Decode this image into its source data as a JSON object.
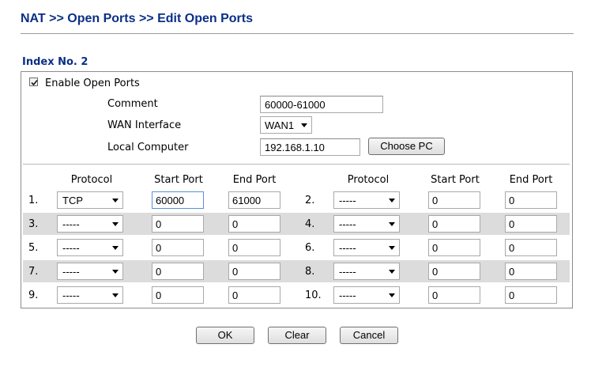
{
  "breadcrumb": "NAT >> Open Ports >> Edit Open Ports",
  "index_label": "Index No. 2",
  "enable": {
    "label": "Enable Open Ports",
    "checked": true
  },
  "form": {
    "comment_label": "Comment",
    "comment_value": "60000-61000",
    "wan_label": "WAN Interface",
    "wan_value": "WAN1",
    "local_label": "Local Computer",
    "local_value": "192.168.1.10",
    "choose_pc": "Choose PC"
  },
  "table": {
    "headers": {
      "protocol_left": "Protocol",
      "start_left": "Start Port",
      "end_left": "End Port",
      "protocol_right": "Protocol",
      "start_right": "Start Port",
      "end_right": "End Port"
    },
    "rows": [
      {
        "left": {
          "num": "1.",
          "protocol": "TCP",
          "start": "60000",
          "end": "61000"
        },
        "right": {
          "num": "2.",
          "protocol": "-----",
          "start": "0",
          "end": "0"
        }
      },
      {
        "left": {
          "num": "3.",
          "protocol": "-----",
          "start": "0",
          "end": "0"
        },
        "right": {
          "num": "4.",
          "protocol": "-----",
          "start": "0",
          "end": "0"
        }
      },
      {
        "left": {
          "num": "5.",
          "protocol": "-----",
          "start": "0",
          "end": "0"
        },
        "right": {
          "num": "6.",
          "protocol": "-----",
          "start": "0",
          "end": "0"
        }
      },
      {
        "left": {
          "num": "7.",
          "protocol": "-----",
          "start": "0",
          "end": "0"
        },
        "right": {
          "num": "8.",
          "protocol": "-----",
          "start": "0",
          "end": "0"
        }
      },
      {
        "left": {
          "num": "9.",
          "protocol": "-----",
          "start": "0",
          "end": "0"
        },
        "right": {
          "num": "10.",
          "protocol": "-----",
          "start": "0",
          "end": "0"
        }
      }
    ]
  },
  "buttons": {
    "ok": "OK",
    "clear": "Clear",
    "cancel": "Cancel"
  },
  "colors": {
    "title": "#0b2f86",
    "row_shade": "#dcdcdc"
  }
}
